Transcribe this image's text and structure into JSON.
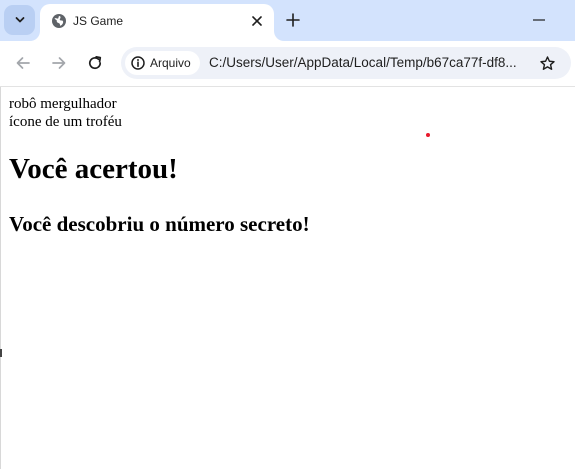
{
  "browser": {
    "tab": {
      "title": "JS Game",
      "favicon": "globe-icon"
    },
    "toolbar": {
      "security_chip": "Arquivo",
      "url": "C:/Users/User/AppData/Local/Temp/b67ca77f-df8..."
    },
    "icons": {
      "tab_search": "chevron-down-icon",
      "close": "close-icon",
      "new_tab": "plus-icon",
      "minimize": "minimize-icon",
      "back": "arrow-left-icon",
      "forward": "arrow-right-icon",
      "reload": "reload-icon",
      "info": "info-icon",
      "bookmark": "star-icon"
    },
    "colors": {
      "tabstrip": "#d3e3fd",
      "omnibox": "#eef1f8",
      "dot": "#e8192c"
    }
  },
  "page": {
    "images": [
      {
        "alt": "robô mergulhador"
      },
      {
        "alt": "ícone de um troféu"
      }
    ],
    "heading": "Você acertou!",
    "subheading": "Você descobriu o número secreto!"
  }
}
